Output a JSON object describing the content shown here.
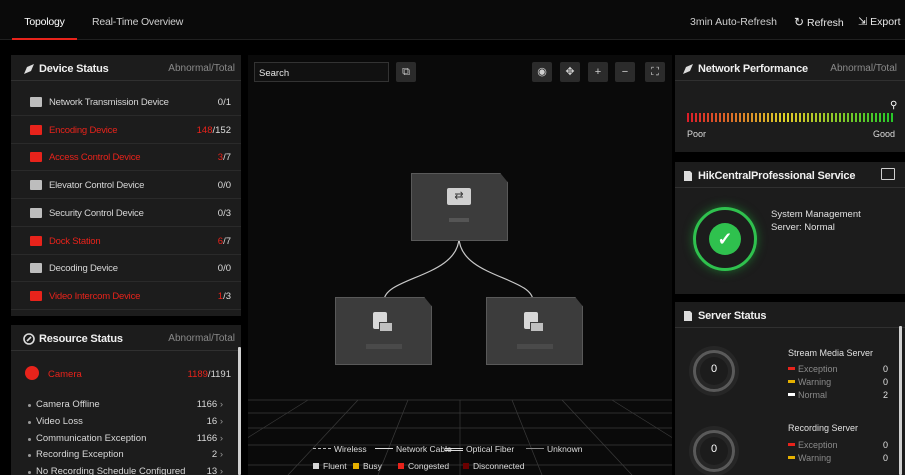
{
  "topbar": {
    "tabs": [
      "Topology",
      "Real-Time Overview"
    ],
    "active_tab": 0,
    "auto_refresh_label": "3min Auto-Refresh",
    "refresh_label": "Refresh",
    "export_label": "Export"
  },
  "device_status": {
    "title": "Device Status",
    "header_right": "Abnormal/Total",
    "rows": [
      {
        "name": "Network Transmission Device",
        "abnormal": "0",
        "total": "1",
        "state": "normal",
        "icon": "network-device-icon"
      },
      {
        "name": "Encoding Device",
        "abnormal": "148",
        "total": "152",
        "state": "alert",
        "icon": "encoding-device-icon"
      },
      {
        "name": "Access Control Device",
        "abnormal": "3",
        "total": "7",
        "state": "alert",
        "icon": "access-control-icon"
      },
      {
        "name": "Elevator Control Device",
        "abnormal": "0",
        "total": "0",
        "state": "normal",
        "icon": "elevator-control-icon"
      },
      {
        "name": "Security Control Device",
        "abnormal": "0",
        "total": "3",
        "state": "normal",
        "icon": "security-control-icon"
      },
      {
        "name": "Dock Station",
        "abnormal": "6",
        "total": "7",
        "state": "alert",
        "icon": "dock-station-icon"
      },
      {
        "name": "Decoding Device",
        "abnormal": "0",
        "total": "0",
        "state": "normal",
        "icon": "decoding-device-icon"
      },
      {
        "name": "Video Intercom Device",
        "abnormal": "1",
        "total": "3",
        "state": "alert",
        "icon": "video-intercom-icon"
      }
    ]
  },
  "resource_status": {
    "title": "Resource Status",
    "header_right": "Abnormal/Total",
    "camera": {
      "name": "Camera",
      "abnormal": "1189",
      "total": "1191"
    },
    "items": [
      {
        "label": "Camera Offline",
        "value": "1166"
      },
      {
        "label": "Video Loss",
        "value": "16"
      },
      {
        "label": "Communication Exception",
        "value": "1166"
      },
      {
        "label": "Recording Exception",
        "value": "2"
      },
      {
        "label": "No Recording Schedule Configured",
        "value": "13"
      }
    ]
  },
  "canvas": {
    "search_placeholder": "Search",
    "tools": [
      "eye-icon",
      "move-icon",
      "zoom-in-icon",
      "zoom-out-icon",
      "fit-screen-icon"
    ],
    "tool_glyphs": [
      "◉",
      "✥",
      "+",
      "−",
      "⛶"
    ],
    "nodes": [
      {
        "kind": "switch",
        "icon": "network-switch-icon"
      },
      {
        "kind": "encoder",
        "icon": "encoding-device-icon"
      },
      {
        "kind": "encoder",
        "icon": "encoding-device-icon"
      }
    ],
    "legend_lines": [
      "Wireless",
      "Network Cable",
      "Optical Fiber",
      "Unknown"
    ],
    "legend_states": [
      {
        "label": "Fluent",
        "color": "#d6d6d6"
      },
      {
        "label": "Busy",
        "color": "#e5b000"
      },
      {
        "label": "Congested",
        "color": "#e8231b"
      },
      {
        "label": "Disconnected",
        "color": "#6a0000"
      }
    ]
  },
  "network_performance": {
    "title": "Network Performance",
    "header_right": "Abnormal/Total",
    "poor_label": "Poor",
    "good_label": "Good",
    "level": 1.0
  },
  "hikcentral_service": {
    "title": "HikCentralProfessional Service",
    "status_line1": "System Management",
    "status_line2": "Server: Normal"
  },
  "server_status": {
    "title": "Server Status",
    "servers": [
      {
        "name": "Stream Media Server",
        "count": "0",
        "rows": [
          {
            "label": "Exception",
            "value": "0",
            "color": "#e8231b"
          },
          {
            "label": "Warning",
            "value": "0",
            "color": "#e5b000"
          },
          {
            "label": "Normal",
            "value": "2",
            "color": "#ffffff"
          }
        ]
      },
      {
        "name": "Recording Server",
        "count": "0",
        "rows": [
          {
            "label": "Exception",
            "value": "0",
            "color": "#e8231b"
          },
          {
            "label": "Warning",
            "value": "0",
            "color": "#e5b000"
          }
        ]
      }
    ]
  },
  "colors": {
    "accent": "#e8231b",
    "ok": "#2fc14e",
    "warn": "#e5b000"
  }
}
